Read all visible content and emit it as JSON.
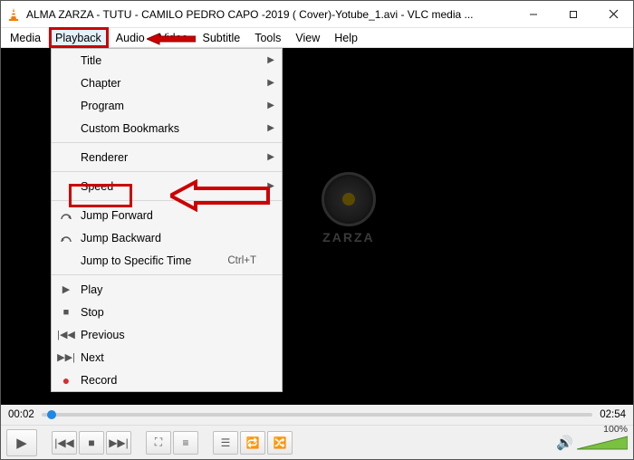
{
  "titlebar": {
    "title": "ALMA ZARZA - TUTU - CAMILO PEDRO CAPO -2019 ( Cover)-Yotube_1.avi - VLC media ..."
  },
  "menubar": {
    "media": "Media",
    "playback": "Playback",
    "audio": "Audio",
    "video": "Video",
    "subtitle": "Subtitle",
    "tools": "Tools",
    "view": "View",
    "help": "Help"
  },
  "dropdown": {
    "title_label": "Title",
    "chapter_label": "Chapter",
    "program_label": "Program",
    "custom_bookmarks": "Custom Bookmarks",
    "renderer": "Renderer",
    "speed": "Speed",
    "jump_forward": "Jump Forward",
    "jump_backward": "Jump Backward",
    "jump_specific": "Jump to Specific Time",
    "jump_specific_accel": "Ctrl+T",
    "play": "Play",
    "stop": "Stop",
    "previous": "Previous",
    "next": "Next",
    "record": "Record"
  },
  "logo": {
    "text": "ZARZA"
  },
  "seek": {
    "current": "00:02",
    "total": "02:54"
  },
  "volume": {
    "percent": "100%"
  }
}
